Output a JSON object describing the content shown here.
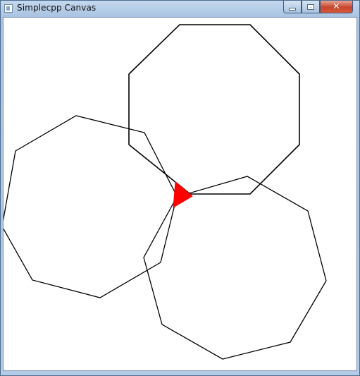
{
  "window": {
    "title": "Simplecpp Canvas",
    "controls": {
      "minimize_icon": "minimize-icon",
      "maximize_icon": "maximize-icon",
      "close_icon": "close-icon",
      "close_glyph": "✕"
    }
  },
  "colors": {
    "stroke": "#000000",
    "turtle": "#ff0000",
    "background": "#ffffff"
  }
}
